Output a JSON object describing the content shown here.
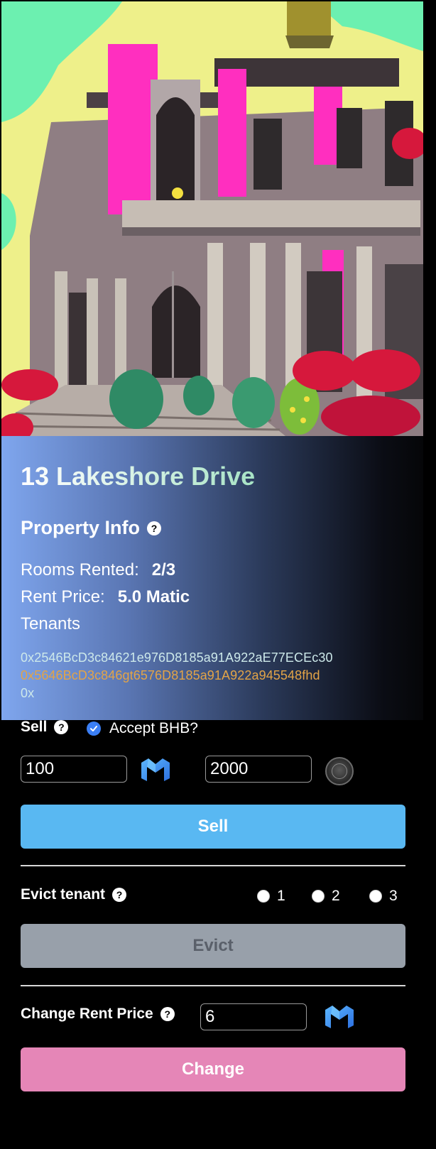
{
  "property": {
    "name": "13 Lakeshore Drive"
  },
  "info": {
    "heading": "Property Info",
    "rooms_label": "Rooms Rented:",
    "rooms_value": "2/3",
    "rent_label": "Rent Price:",
    "rent_value": "5.0 Matic",
    "tenants_label": "Tenants",
    "tenants": [
      "0x2546BcD3c84621e976D8185a91A922aE77ECEc30",
      "0x5646BcD3c846gt6576D8185a91A922a945548fhd",
      "0x"
    ]
  },
  "sell": {
    "label": "Sell",
    "accept_label": "Accept BHB?",
    "accept_checked": true,
    "matic_amount": "100",
    "bhb_amount": "2000",
    "button_label": "Sell"
  },
  "evict": {
    "label": "Evict tenant",
    "options": [
      "1",
      "2",
      "3"
    ],
    "button_label": "Evict"
  },
  "change_rent": {
    "label": "Change Rent Price",
    "value": "6",
    "button_label": "Change"
  },
  "colors": {
    "sell_button": "#59b8f2",
    "evict_button": "#98a0aa",
    "change_button": "#e586b7",
    "accept_check": "#3b7ff5",
    "tenant_highlight": "#e3a447"
  },
  "icons": {
    "matic": "matic-icon",
    "bhb": "bhb-coin-icon",
    "help": "help-icon"
  }
}
